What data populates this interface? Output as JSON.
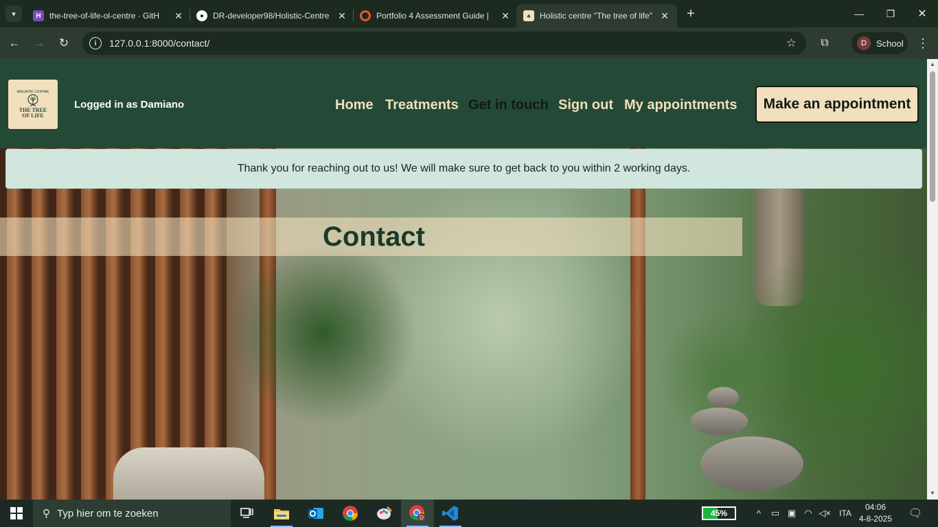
{
  "browser": {
    "tabs": [
      {
        "title": "the-tree-of-life-ol-centre · GitH",
        "icon": "heroku-icon"
      },
      {
        "title": "DR-developer98/Holistic-Centre",
        "icon": "github-icon"
      },
      {
        "title": "Portfolio 4 Assessment Guide | ",
        "icon": "ci-icon"
      },
      {
        "title": "Holistic centre \"The tree of life\"",
        "icon": "site-favicon",
        "active": true
      }
    ],
    "url": "127.0.0.1:8000/contact/",
    "profile_initial": "D",
    "profile_name": "School"
  },
  "site": {
    "logo": {
      "arc_text": "HOLISTIC CENTRE",
      "name": "THE TREE OF LIFE"
    },
    "logged_in": "Logged in as Damiano",
    "nav": [
      {
        "label": "Home",
        "current": false
      },
      {
        "label": "Treatments",
        "current": false
      },
      {
        "label": "Get in touch",
        "current": true
      },
      {
        "label": "Sign out",
        "current": false
      },
      {
        "label": "My appointments",
        "current": false
      }
    ],
    "cta": "Make an appointment",
    "alert": "Thank you for reaching out to us! We will make sure to get back to you within 2 working days.",
    "page_title": "Contact",
    "colors": {
      "header_bg": "#244a37",
      "accent": "#f2dfbd",
      "alert_bg": "#d1e7dd"
    }
  },
  "taskbar": {
    "search_placeholder": "Typ hier om te zoeken",
    "apps": [
      "task-view-icon",
      "file-explorer-icon",
      "outlook-icon",
      "chrome-icon",
      "paint-icon",
      "chrome-profile-icon",
      "vscode-icon"
    ],
    "battery_percent": 45,
    "battery_label": "45%",
    "language": "ITA",
    "time": "04:06",
    "date": "4-8-2025"
  }
}
